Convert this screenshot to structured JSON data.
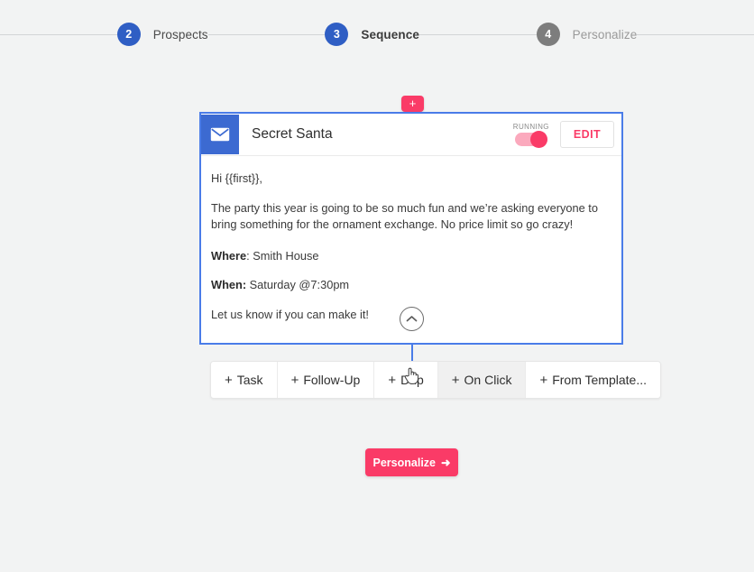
{
  "colors": {
    "background": "#f2f3f3",
    "accent_pink": "#fa3b67",
    "accent_blue": "#2f5ec4",
    "card_border_blue": "#4a7ce8",
    "step_inactive_gray": "#7d7d7d"
  },
  "stepper": {
    "steps": [
      {
        "number": "2",
        "label": "Prospects",
        "state": "done"
      },
      {
        "number": "3",
        "label": "Sequence",
        "state": "active"
      },
      {
        "number": "4",
        "label": "Personalize",
        "state": "todo"
      }
    ]
  },
  "add_step": {
    "label": "+"
  },
  "email_card": {
    "icon": "envelope-icon",
    "title": "Secret Santa",
    "status_label": "RUNNING",
    "status_on": true,
    "edit_label": "EDIT",
    "collapse_icon": "chevron-up-icon",
    "body": {
      "greeting": "Hi {{first}},",
      "paragraph": "The party this year is going to be so much fun and we’re asking everyone to bring something for the ornament exchange.  No price limit so go crazy!",
      "where_label": "Where",
      "where_value": ": Smith House",
      "when_label": "When:",
      "when_value": " Saturday @7:30pm",
      "closing": "Let us know if you can make it!"
    }
  },
  "action_bar": {
    "buttons": [
      {
        "plus": "+",
        "label": "Task",
        "hover": false
      },
      {
        "plus": "+",
        "label": "Follow-Up",
        "hover": false
      },
      {
        "plus": "+",
        "label": "Drip",
        "hover": false
      },
      {
        "plus": "+",
        "label": "On Click",
        "hover": true
      },
      {
        "plus": "+",
        "label": "From Template...",
        "hover": false
      }
    ]
  },
  "footer": {
    "personalize_label": "Personalize",
    "personalize_arrow": "➜"
  }
}
